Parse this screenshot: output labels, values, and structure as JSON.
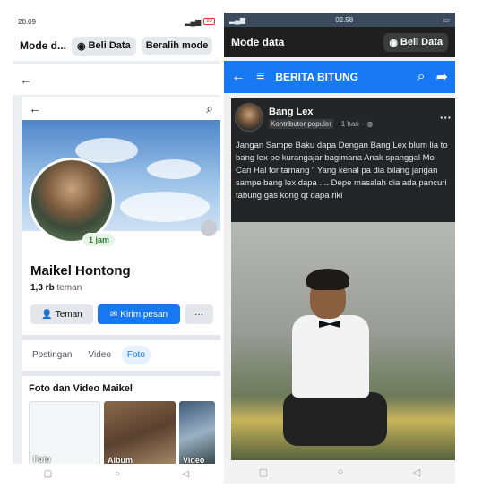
{
  "left": {
    "status": {
      "time": "20.09",
      "battery": "83"
    },
    "modebar": {
      "title": "Mode d...",
      "buy_label": "Beli Data",
      "switch_label": "Beralih mode"
    },
    "profile": {
      "back_glyph": "←",
      "name": "Maikel Hontong",
      "friends_count": "1,3 rb",
      "friends_word": "teman",
      "badge": "1 jam",
      "buttons": {
        "friend": "Teman",
        "message": "Kirim pesan",
        "more": "···"
      },
      "tabs": [
        "Postingan",
        "Video",
        "Foto"
      ],
      "active_tab": "Foto",
      "section_title": "Foto dan Video Maikel",
      "thumbs": [
        "Foto",
        "Album",
        "Video"
      ]
    }
  },
  "right": {
    "status": {
      "time": "02.58"
    },
    "modebar": {
      "title": "Mode data",
      "buy_label": "Beli Data"
    },
    "header": {
      "title": "BERITA BITUNG"
    },
    "post": {
      "author": "Bang Lex",
      "role": "Kontributor populer",
      "time": "1 hari",
      "text": "Jangan Sampe Baku dapa Dengan Bang Lex blum lia to bang lex pe kurangajar bagimana Anak spanggal Mo Cari Hal for tamang \" Yang kenal pa dia bilang jangan sampe bang lex dapa .... Depe masalah dia ada pancuri tabung gas kong qt dapa riki"
    }
  },
  "colors": {
    "facebook_blue": "#1877f2",
    "dark_card": "#242526",
    "online_green": "#2e7d32"
  }
}
